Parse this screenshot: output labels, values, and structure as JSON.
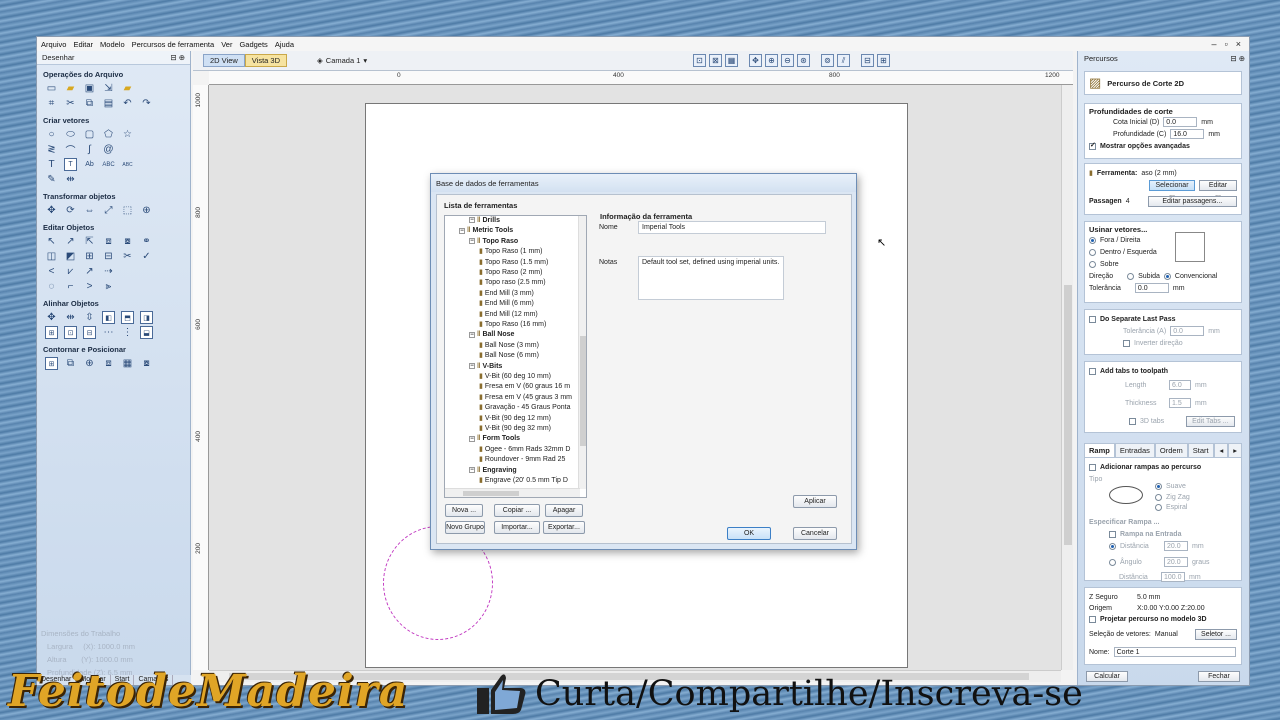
{
  "menu": [
    "Arquivo",
    "Editar",
    "Modelo",
    "Percursos de ferramenta",
    "Ver",
    "Gadgets",
    "Ajuda"
  ],
  "left_panel": {
    "title": "Desenhar",
    "sections": [
      "Operações do Arquivo",
      "Criar vetores",
      "Transformar objetos",
      "Editar Objetos",
      "Alinhar Objetos",
      "Contornar e Posicionar"
    ],
    "dims_title": "Dimensões do Trabalho",
    "dims": [
      {
        "label": "Largura",
        "value": "(X): 1000.0 mm"
      },
      {
        "label": "Altura",
        "value": "(Y): 1000.0 mm"
      },
      {
        "label": "Profundidade (Z):",
        "value": "6.5 mm"
      }
    ],
    "tabs": [
      "Desenhar",
      "Modelar",
      "Start",
      "Camadas"
    ]
  },
  "view": {
    "tab_2d": "2D View",
    "tab_3d": "Vista 3D",
    "layer": "Camada 1",
    "hruler": [
      "0",
      "400",
      "800",
      "1200"
    ],
    "vruler": [
      "1000",
      "800",
      "600",
      "400",
      "200"
    ]
  },
  "dialog": {
    "title": "Base de dados de ferramentas",
    "list_label": "Lista de ferramentas",
    "info_label": "Informação da ferramenta",
    "name_label": "Nome",
    "name_value": "Imperial Tools",
    "notes_label": "Notas",
    "notes_value": "Default tool set, defined using imperial units.",
    "tree": [
      {
        "text": "Drills",
        "level": 2,
        "group": true
      },
      {
        "text": "Metric Tools",
        "level": 1,
        "group": true
      },
      {
        "text": "Topo Raso",
        "level": 2,
        "group": true
      },
      {
        "text": "Topo Raso (1 mm)",
        "level": 3
      },
      {
        "text": "Topo Raso (1.5 mm)",
        "level": 3
      },
      {
        "text": "Topo Raso (2 mm)",
        "level": 3
      },
      {
        "text": "Topo raso (2.5 mm)",
        "level": 3
      },
      {
        "text": "End Mill (3 mm)",
        "level": 3
      },
      {
        "text": "End Mill (6 mm)",
        "level": 3
      },
      {
        "text": "End Mill (12 mm)",
        "level": 3
      },
      {
        "text": "Topo Raso (16 mm)",
        "level": 3
      },
      {
        "text": "Ball Nose",
        "level": 2,
        "group": true
      },
      {
        "text": "Ball Nose (3 mm)",
        "level": 3
      },
      {
        "text": "Ball Nose (6 mm)",
        "level": 3
      },
      {
        "text": "V-Bits",
        "level": 2,
        "group": true
      },
      {
        "text": "V-Bit (60 deg 10 mm)",
        "level": 3
      },
      {
        "text": "Fresa em V (60 graus 16 m",
        "level": 3
      },
      {
        "text": "Fresa em V (45 graus 3 mm",
        "level": 3
      },
      {
        "text": "Gravação - 45 Graus Ponta",
        "level": 3
      },
      {
        "text": "V-Bit (90 deg 12 mm)",
        "level": 3
      },
      {
        "text": "V-Bit (90 deg 32 mm)",
        "level": 3
      },
      {
        "text": "Form Tools",
        "level": 2,
        "group": true
      },
      {
        "text": "Ogee - 6mm Rads 32mm D",
        "level": 3
      },
      {
        "text": "Roundover - 9mm Rad 25",
        "level": 3
      },
      {
        "text": "Engraving",
        "level": 2,
        "group": true
      },
      {
        "text": "Engrave (20' 0.5 mm Tip D",
        "level": 3
      }
    ],
    "buttons": {
      "nova": "Nova ...",
      "copiar": "Copiar ...",
      "apagar": "Apagar",
      "novo_grupo": "Novo Grupo",
      "importar": "Importar...",
      "exportar": "Exportar...",
      "aplicar": "Aplicar",
      "ok": "OK",
      "cancelar": "Cancelar"
    }
  },
  "right_panel": {
    "title": "Percursos",
    "op_title": "Percurso de Corte 2D",
    "depths": {
      "title": "Profundidades de corte",
      "start_label": "Cota Inicial (D)",
      "start_value": "0.0",
      "depth_label": "Profundidade (C)",
      "depth_value": "16.0",
      "unit": "mm",
      "advanced": "Mostrar opções avançadas"
    },
    "tool": {
      "label": "Ferramenta:",
      "value": "aso (2 mm)",
      "select": "Selecionar ...",
      "edit": "Editar ...",
      "passes_label": "Passagen",
      "passes_value": "4",
      "edit_passes": "Editar passagens..."
    },
    "machine": {
      "title": "Usinar vetores...",
      "options": [
        "Fora / Direita",
        "Dentro / Esquerda",
        "Sobre"
      ],
      "direction_label": "Direção",
      "dir_options": [
        "Subida",
        "Convencional"
      ],
      "tolerance_label": "Tolerância",
      "tolerance_value": "0.0",
      "unit": "mm"
    },
    "separate": {
      "title": "Do Separate Last Pass",
      "tol_label": "Tolerância (A)",
      "tol_value": "0.0",
      "unit": "mm",
      "invert": "Inverter direção"
    },
    "tabs_box": {
      "title": "Add tabs to toolpath",
      "length_label": "Length",
      "length_value": "6.0",
      "thick_label": "Thickness",
      "thick_value": "1.5",
      "unit": "mm",
      "tabs3d": "3D tabs",
      "edit": "Edit Tabs ..."
    },
    "ramp_tabs": [
      "Ramp",
      "Entradas",
      "Ordem",
      "Start At"
    ],
    "ramp": {
      "add": "Adicionar rampas ao percurso",
      "type_label": "Tipo",
      "types": [
        "Suave",
        "Zig Zag",
        "Espiral"
      ],
      "specify": "Especificar Rampa ...",
      "ramp_entry": "Rampa na Entrada",
      "dist_label": "Distância",
      "dist_value": "20.0",
      "angle_label": "Ângulo",
      "angle_value": "20.0",
      "angle_unit": "graus",
      "dist2_label": "Distância",
      "dist2_value": "100.0",
      "unit": "mm"
    },
    "bottom": {
      "zsafe_label": "Z Seguro",
      "zsafe_value": "5.0 mm",
      "origin_label": "Origem",
      "origin_value": "X:0.00 Y:0.00 Z:20.00",
      "project": "Projetar percurso no modelo 3D",
      "vec_sel_label": "Seleção de vetores:",
      "vec_sel_value": "Manual",
      "selector": "Seletor ...",
      "name_label": "Nome:",
      "name_value": "Corte 1",
      "calc": "Calcular",
      "close": "Fechar"
    }
  },
  "overlay": {
    "brand": "FeitodeMadeira",
    "cta": "Curta/Compartilhe/Inscreva-se"
  }
}
